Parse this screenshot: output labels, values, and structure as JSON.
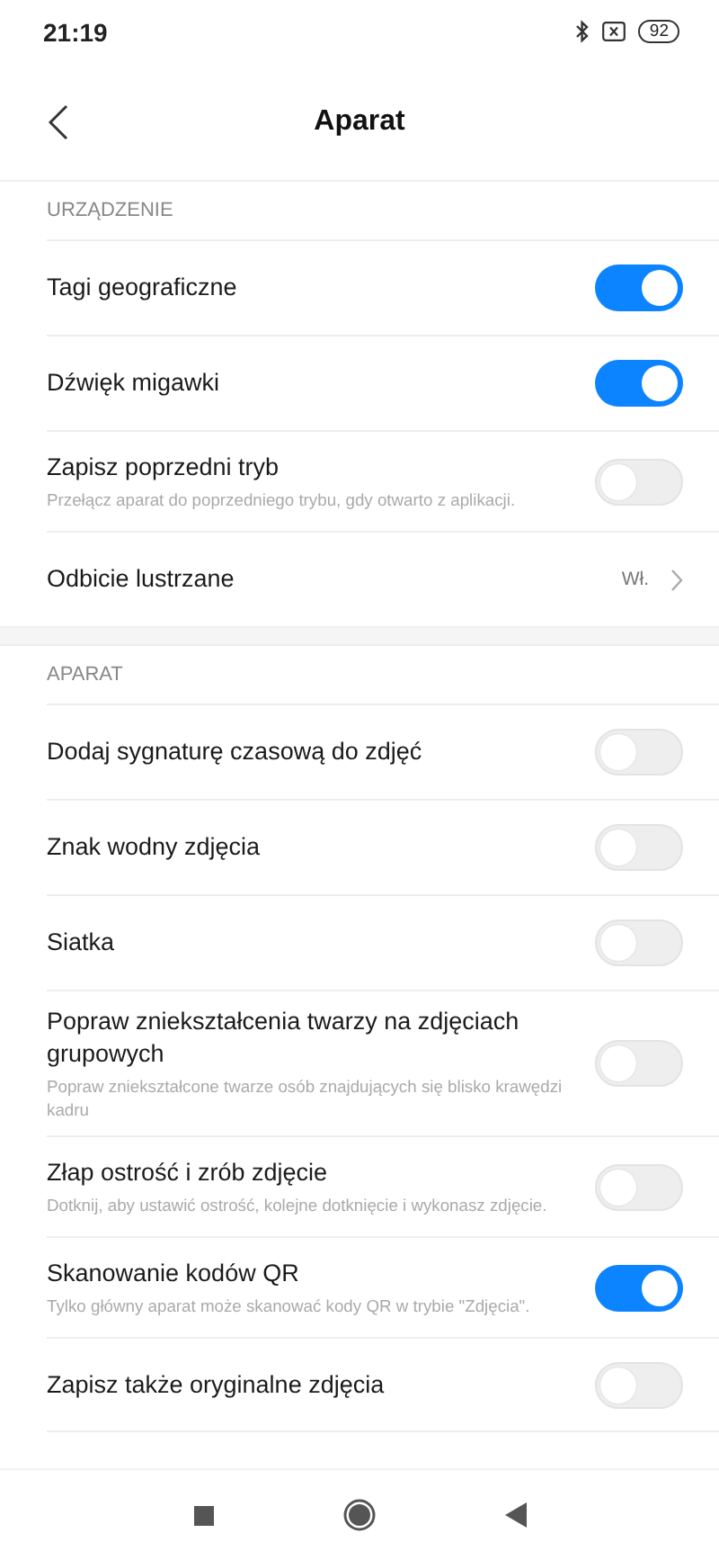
{
  "status_bar": {
    "time": "21:19",
    "battery": "92"
  },
  "header": {
    "title": "Aparat"
  },
  "sections": [
    {
      "title": "URZĄDZENIE",
      "items": [
        {
          "kind": "toggle",
          "label": "Tagi geograficzne",
          "on": true
        },
        {
          "kind": "toggle",
          "label": "Dźwięk migawki",
          "on": true
        },
        {
          "kind": "toggle",
          "label": "Zapisz poprzedni tryb",
          "subtitle": "Przełącz aparat do poprzedniego trybu, gdy otwarto z aplikacji.",
          "on": false
        },
        {
          "kind": "link",
          "label": "Odbicie lustrzane",
          "value": "Wł."
        }
      ]
    },
    {
      "title": "APARAT",
      "items": [
        {
          "kind": "toggle",
          "label": "Dodaj sygnaturę czasową do zdjęć",
          "on": false
        },
        {
          "kind": "toggle",
          "label": "Znak wodny zdjęcia",
          "on": false
        },
        {
          "kind": "toggle",
          "label": "Siatka",
          "on": false
        },
        {
          "kind": "toggle",
          "label": "Popraw zniekształcenia twarzy na zdjęciach grupowych",
          "subtitle": "Popraw zniekształcone twarze osób znajdujących się blisko krawędzi kadru",
          "on": false
        },
        {
          "kind": "toggle",
          "label": "Złap ostrość i zrób zdjęcie",
          "subtitle": "Dotknij, aby ustawić ostrość, kolejne dotknięcie i wykonasz zdjęcie.",
          "on": false
        },
        {
          "kind": "toggle",
          "label": "Skanowanie kodów QR",
          "subtitle": "Tylko główny aparat może skanować kody QR w trybie \"Zdjęcia\".",
          "on": true
        },
        {
          "kind": "toggle",
          "label": "Zapisz także oryginalne zdjęcia",
          "on": false
        }
      ]
    }
  ]
}
